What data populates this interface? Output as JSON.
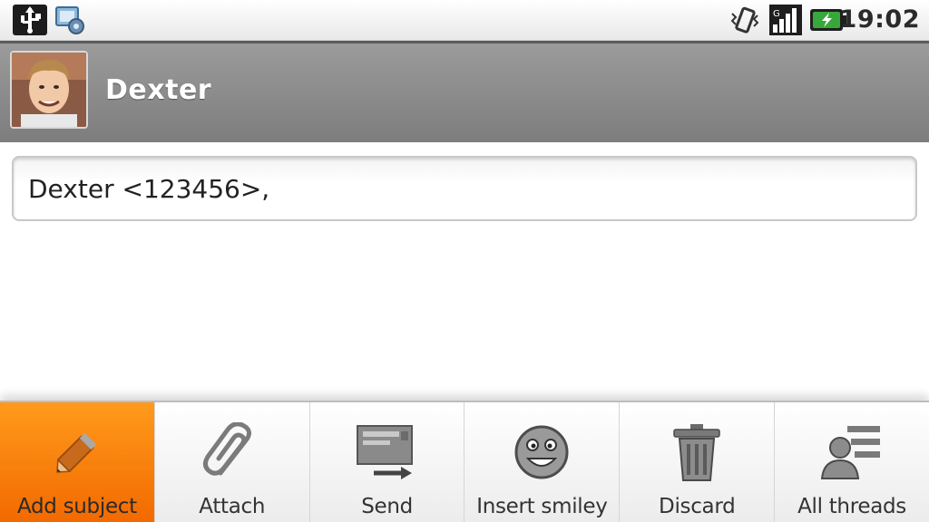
{
  "status_bar": {
    "time": "19:02",
    "icons": [
      "usb-icon",
      "sync-icon",
      "vibrate-icon",
      "signal-icon",
      "battery-icon"
    ],
    "battery_color": "#2e9b2e"
  },
  "header": {
    "contact_name": "Dexter",
    "avatar_icon": "contact-photo"
  },
  "recipients": {
    "value": "Dexter <123456>,"
  },
  "menu": {
    "accent_color": "#f57c00",
    "items": [
      {
        "label": "Add subject",
        "icon": "pencil-icon",
        "selected": true
      },
      {
        "label": "Attach",
        "icon": "paperclip-icon",
        "selected": false
      },
      {
        "label": "Send",
        "icon": "send-icon",
        "selected": false
      },
      {
        "label": "Insert smiley",
        "icon": "smiley-icon",
        "selected": false
      },
      {
        "label": "Discard",
        "icon": "trash-icon",
        "selected": false
      },
      {
        "label": "All threads",
        "icon": "threads-icon",
        "selected": false
      }
    ]
  }
}
